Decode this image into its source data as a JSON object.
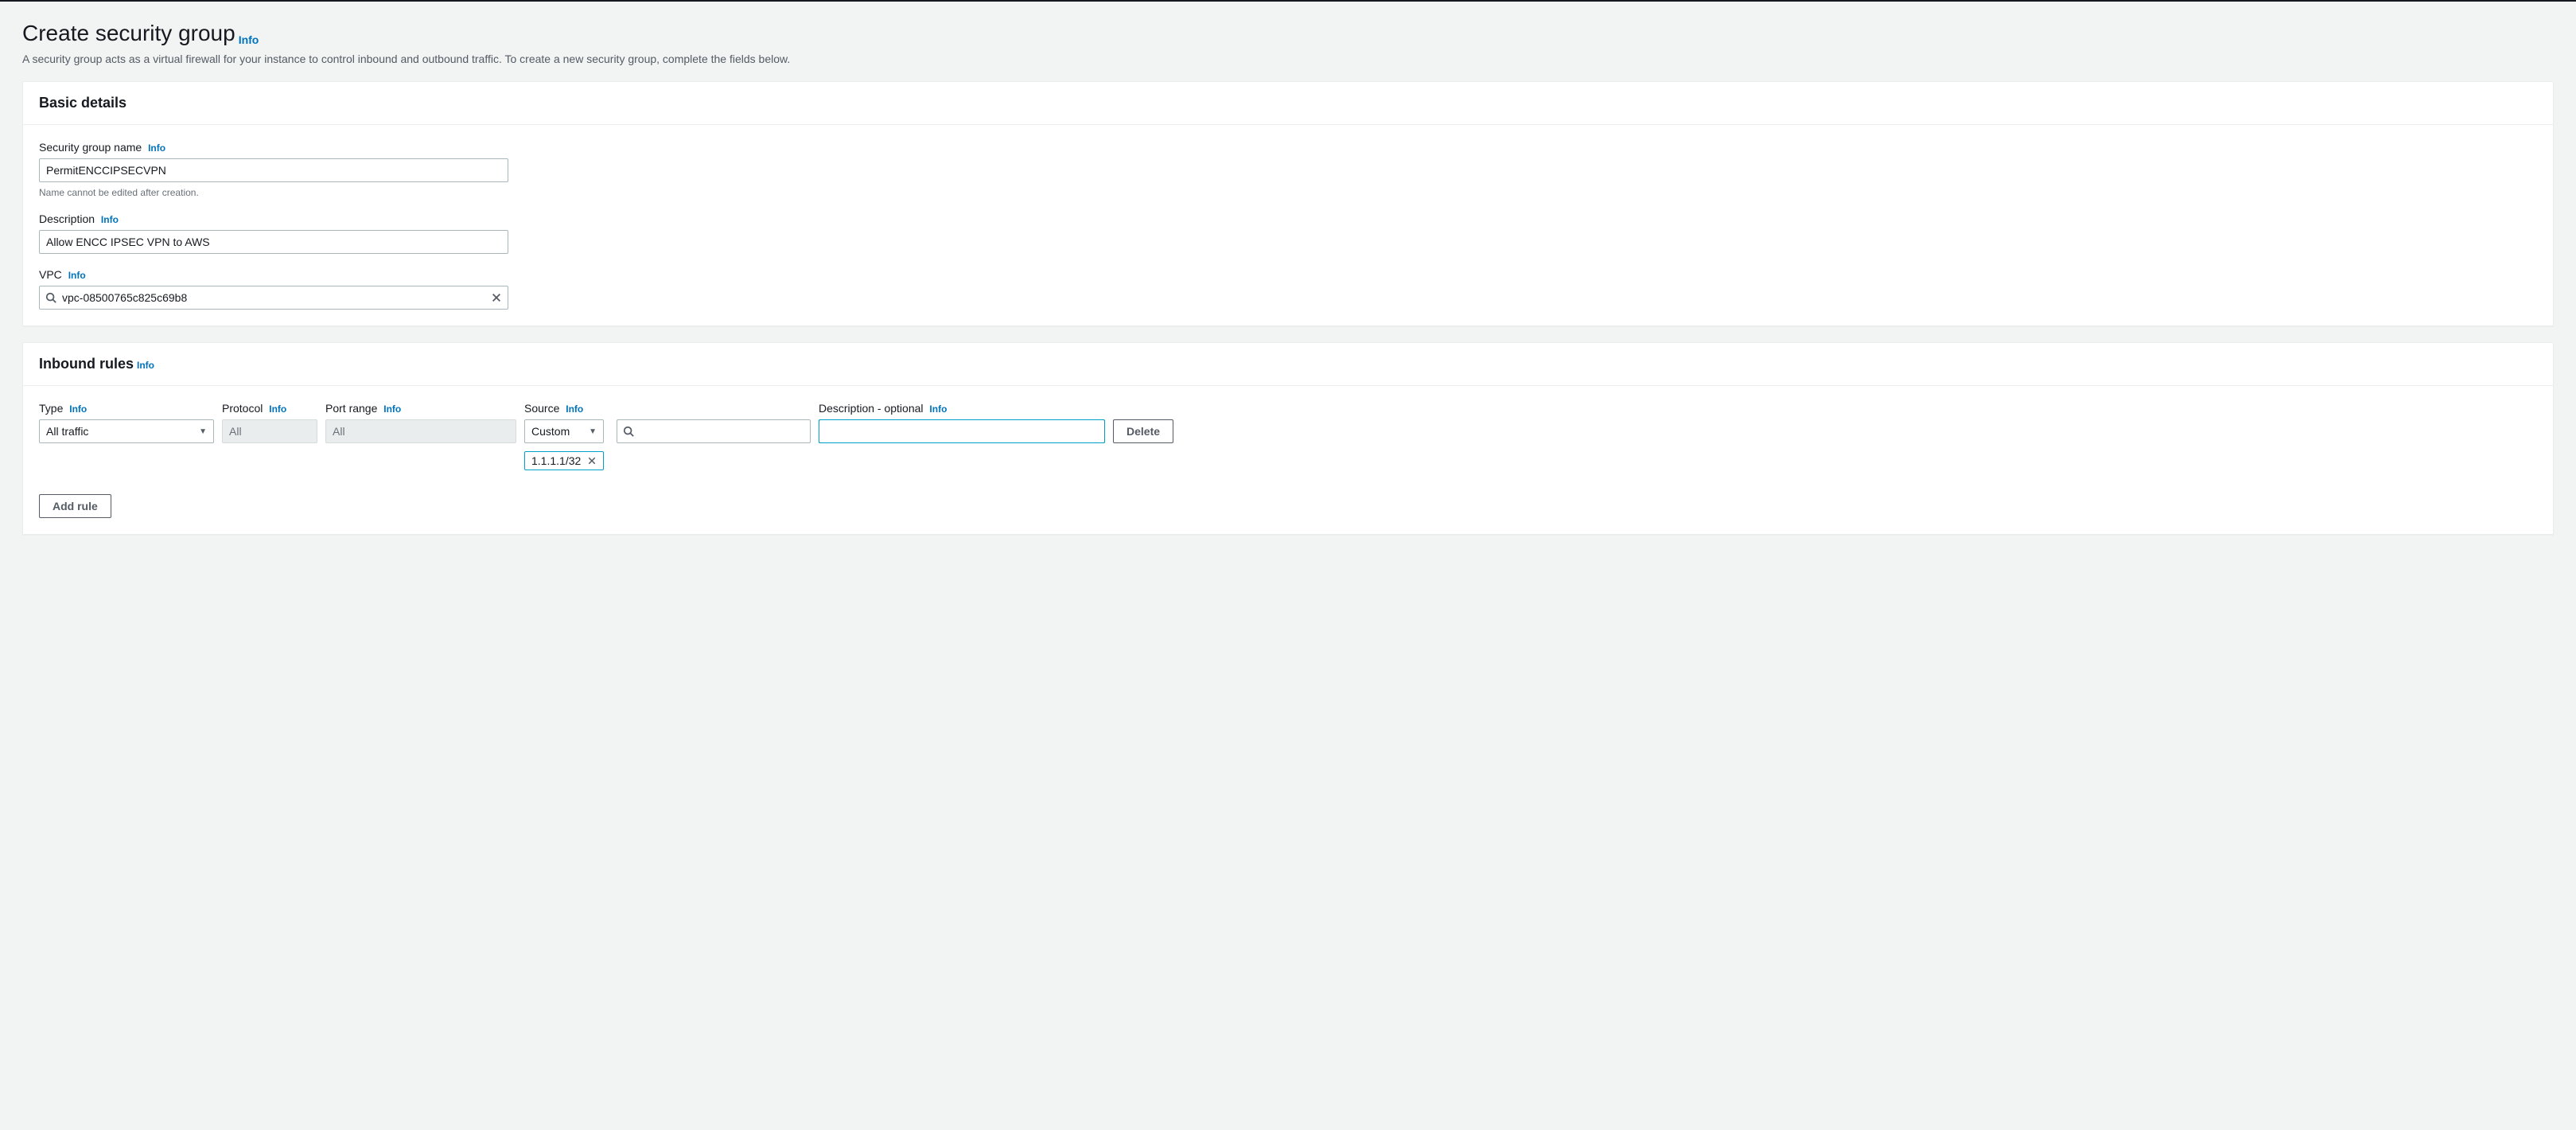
{
  "page": {
    "title": "Create security group",
    "title_info": "Info",
    "subtitle": "A security group acts as a virtual firewall for your instance to control inbound and outbound traffic. To create a new security group, complete the fields below."
  },
  "basic_details": {
    "panel_title": "Basic details",
    "name_label": "Security group name",
    "name_info": "Info",
    "name_value": "PermitENCCIPSECVPN",
    "name_hint": "Name cannot be edited after creation.",
    "desc_label": "Description",
    "desc_info": "Info",
    "desc_value": "Allow ENCC IPSEC VPN to AWS",
    "vpc_label": "VPC",
    "vpc_info": "Info",
    "vpc_value": "vpc-08500765c825c69b8"
  },
  "inbound": {
    "panel_title": "Inbound rules",
    "panel_info": "Info",
    "columns": {
      "type": "Type",
      "type_info": "Info",
      "protocol": "Protocol",
      "protocol_info": "Info",
      "port_range": "Port range",
      "port_range_info": "Info",
      "source": "Source",
      "source_info": "Info",
      "description": "Description - optional",
      "description_info": "Info"
    },
    "rule": {
      "type_selected": "All traffic",
      "protocol": "All",
      "port_range": "All",
      "source_mode": "Custom",
      "source_tag": "1.1.1.1/32",
      "description_value": "",
      "delete_label": "Delete"
    },
    "add_rule_label": "Add rule"
  }
}
